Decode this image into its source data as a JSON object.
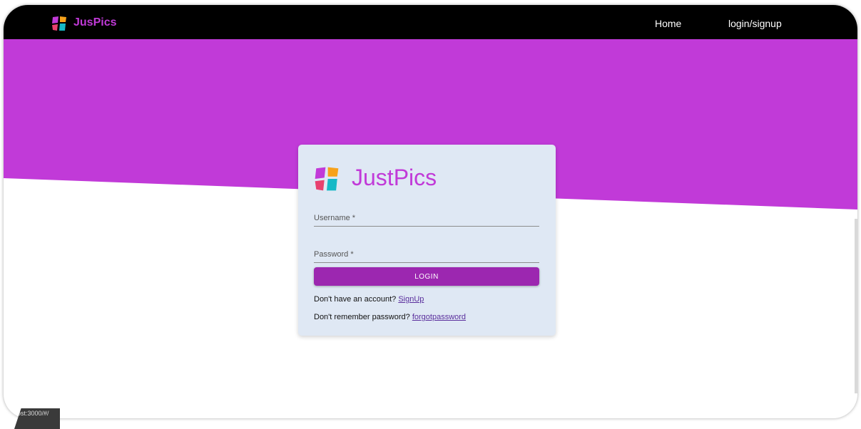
{
  "navbar": {
    "brand": "JusPics",
    "links": {
      "home": "Home",
      "login_signup": "login/signup"
    },
    "logo_icon": "colorful-leaf-logo-icon",
    "background": "#000000",
    "brand_color": "#c13ad8"
  },
  "hero": {
    "color": "#c13ad8"
  },
  "login_card": {
    "brand": "JustPics",
    "logo_icon": "colorful-leaf-logo-icon",
    "username_label": "Username *",
    "password_label": "Password *",
    "login_button": "LOGIN",
    "signup_prompt": "Don't have an account?",
    "signup_link": "SignUp",
    "forgot_prompt": "Don't remember password?",
    "forgot_link": "forgotpassword",
    "background": "#dfe8f4",
    "button_color": "#9c27b0"
  },
  "status_bar": {
    "url": "ost:3000/#/"
  }
}
